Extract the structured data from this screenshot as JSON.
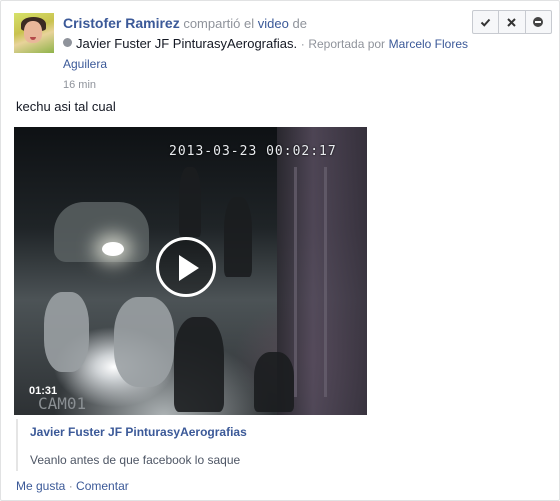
{
  "post": {
    "author": "Cristofer Ramirez",
    "shared_text": "compartió el",
    "object_word": "video",
    "object_suffix": "de",
    "source_page": "Javier Fuster JF PinturasyAerografias.",
    "separator": "·",
    "reported_by_label": "Reportada por",
    "reported_by_name": "Marcelo Flores",
    "reported_by_name_cont": "Aguilera",
    "timestamp": "16 min",
    "status_text": "kechu asi tal cual"
  },
  "actions": {
    "approve_icon": "check-icon",
    "close_icon": "close-icon",
    "hide_icon": "minus-circle-icon"
  },
  "video": {
    "overlay_timestamp": "2013-03-23 00:02:17",
    "camera_label": "CAM01",
    "duration": "01:31",
    "play_icon": "play-icon"
  },
  "attachment": {
    "title": "Javier Fuster JF PinturasyAerografias",
    "description": "Veanlo antes de que facebook lo saque"
  },
  "footer": {
    "like": "Me gusta",
    "separator": "·",
    "comment": "Comentar"
  },
  "colors": {
    "link": "#3b5998",
    "muted": "#8f939b",
    "text": "#141823"
  }
}
